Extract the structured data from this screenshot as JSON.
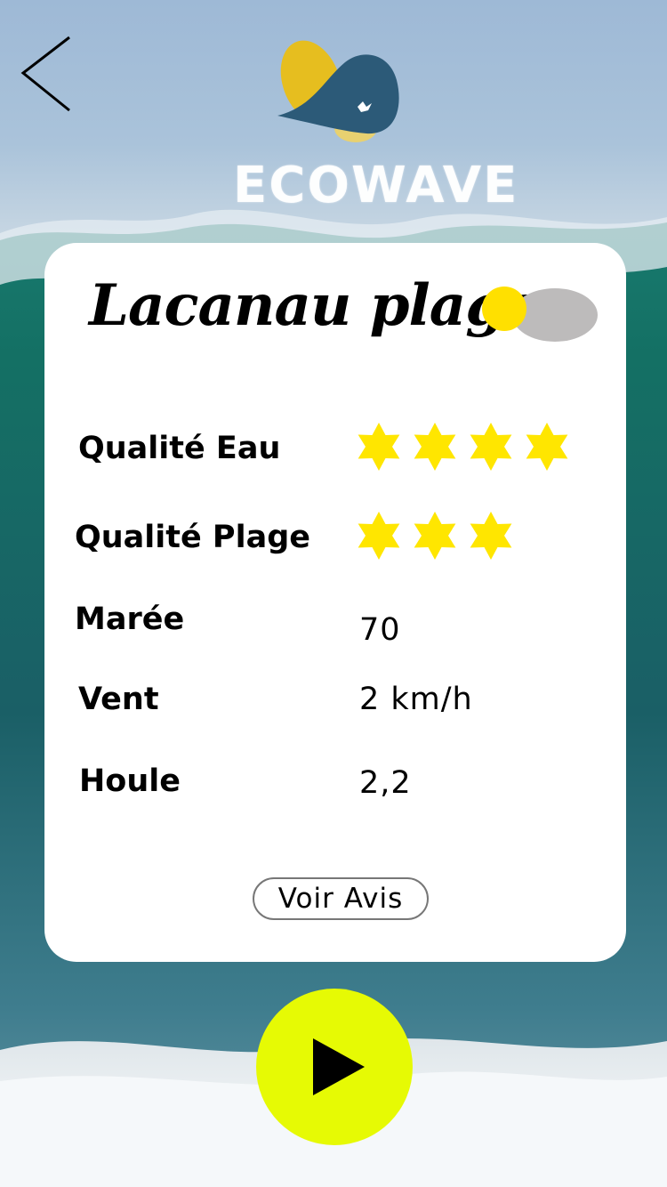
{
  "header": {
    "back_icon": "chevron-left-icon",
    "logo_text": "ECOWAVE"
  },
  "card": {
    "title": "Lacanau plage",
    "weather_icon": "sun-cloud-icon",
    "rows": [
      {
        "label": "Qualité Eau",
        "stars": 4
      },
      {
        "label": "Qualité Plage",
        "stars": 3
      },
      {
        "label": "Marée",
        "value": "70"
      },
      {
        "label": "Vent",
        "value": "2 km/h"
      },
      {
        "label": "Houle",
        "value": "2,2"
      }
    ],
    "reviews_button": "Voir Avis"
  },
  "actions": {
    "play_icon": "play-icon"
  },
  "colors": {
    "star": "#ffe600",
    "play_button": "#e6fa04",
    "sun": "#ffe000",
    "cloud": "#bdbbbb"
  }
}
